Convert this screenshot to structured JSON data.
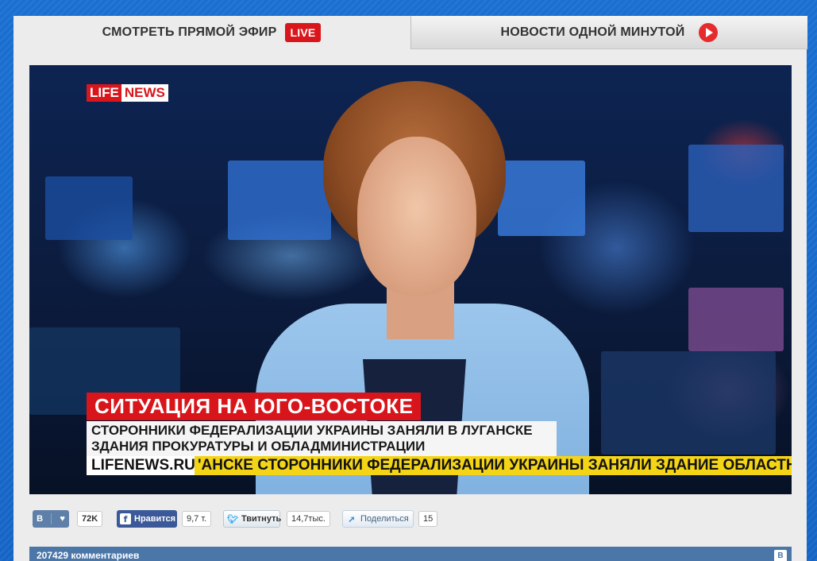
{
  "tabs": {
    "live_label": "СМОТРЕТЬ ПРЯМОЙ ЭФИР",
    "live_badge": "LIVE",
    "minute_label": "НОВОСТИ ОДНОЙ МИНУТОЙ"
  },
  "video": {
    "logo_life": "LIFE",
    "logo_news": "NEWS",
    "headline": "СИТУАЦИЯ НА ЮГО-ВОСТОКЕ",
    "subhead_line1": "СТОРОННИКИ ФЕДЕРАЛИЗАЦИИ УКРАИНЫ ЗАНЯЛИ В ЛУГАНСКЕ",
    "subhead_line2": "ЗДАНИЯ ПРОКУРАТУРЫ И ОБЛАДМИНИСТРАЦИИ",
    "ticker_label": "LIFENEWS.RU",
    "ticker_text": "'АНСКЕ СТОРОННИКИ ФЕДЕРАЛИЗАЦИИ УКРАИНЫ ЗАНЯЛИ ЗДАНИЕ ОБЛАСТНОЙ"
  },
  "social": {
    "vk_label": "В",
    "vk_count": "72K",
    "fb_label": "Нравится",
    "fb_count": "9,7 т.",
    "tw_label": "Твитнуть",
    "tw_count": "14,7тыс.",
    "share_label": "Поделиться",
    "share_count": "15"
  },
  "comments": {
    "title": "207429 комментариев",
    "vk_icon_label": "В"
  },
  "colors": {
    "accent_red": "#d9161c",
    "ticker_yellow": "#f4d417",
    "vk_blue": "#4a76a8",
    "fb_blue": "#3b5998"
  }
}
